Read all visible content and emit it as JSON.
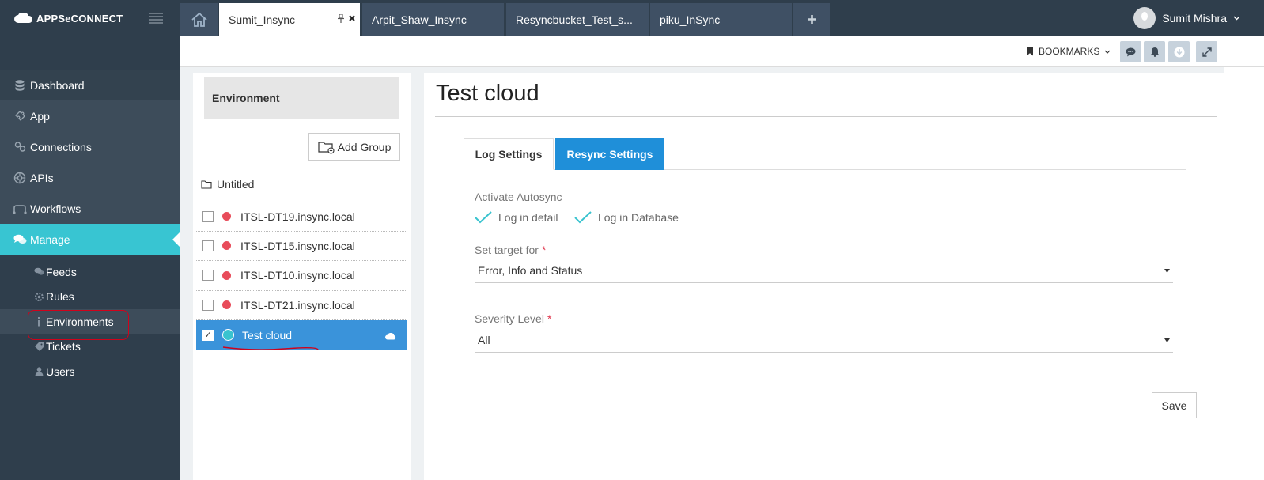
{
  "brand": {
    "name": "APPSeCONNECT"
  },
  "sidebar": {
    "items": [
      {
        "label": "Dashboard",
        "icon": "database-icon"
      },
      {
        "label": "App",
        "icon": "puzzle-icon"
      },
      {
        "label": "Connections",
        "icon": "link-icon"
      },
      {
        "label": "APIs",
        "icon": "gear-circle-icon"
      },
      {
        "label": "Workflows",
        "icon": "workflow-icon"
      },
      {
        "label": "Manage",
        "icon": "comments-icon"
      }
    ],
    "sub_items": [
      {
        "label": "Feeds",
        "icon": "comments-icon"
      },
      {
        "label": "Rules",
        "icon": "cog-icon"
      },
      {
        "label": "Environments",
        "icon": "info-icon"
      },
      {
        "label": "Tickets",
        "icon": "tag-icon"
      },
      {
        "label": "Users",
        "icon": "user-icon"
      }
    ]
  },
  "tabs": [
    {
      "label": "Sumit_Insync"
    },
    {
      "label": "Arpit_Shaw_Insync"
    },
    {
      "label": "Resyncbucket_Test_s..."
    },
    {
      "label": "piku_InSync"
    }
  ],
  "user": {
    "name": "Sumit Mishra"
  },
  "toolbar": {
    "bookmarks_label": "BOOKMARKS"
  },
  "environment_panel": {
    "header": "Environment",
    "add_group_label": "Add Group",
    "group_name": "Untitled",
    "environments": [
      {
        "name": "ITSL-DT19.insync.local",
        "checked": false,
        "status": "offline"
      },
      {
        "name": "ITSL-DT15.insync.local",
        "checked": false,
        "status": "offline"
      },
      {
        "name": "ITSL-DT10.insync.local",
        "checked": false,
        "status": "offline"
      },
      {
        "name": "ITSL-DT21.insync.local",
        "checked": false,
        "status": "offline"
      },
      {
        "name": "Test cloud",
        "checked": true,
        "status": "online",
        "selected": true
      }
    ],
    "checkmark": "✓"
  },
  "main": {
    "title": "Test cloud",
    "tabs": [
      {
        "label": "Log Settings"
      },
      {
        "label": "Resync Settings"
      }
    ],
    "autosync_label": "Activate Autosync",
    "options": [
      {
        "label": "Log in detail"
      },
      {
        "label": "Log in Database"
      }
    ],
    "target_label": "Set target for",
    "target_value": "Error, Info and Status",
    "severity_label": "Severity Level",
    "severity_value": "All",
    "required_mark": "*",
    "save_label": "Save"
  },
  "colors": {
    "sidebar_bg": "#2f3e4c",
    "active_nav": "#38c5d2",
    "tab_bg": "#3f5064",
    "selected_row": "#3a93da",
    "primary_button": "#1f8fd9",
    "offline_dot": "#e84c5a",
    "online_dot": "#39c3cf",
    "annotation": "#d0021b"
  }
}
